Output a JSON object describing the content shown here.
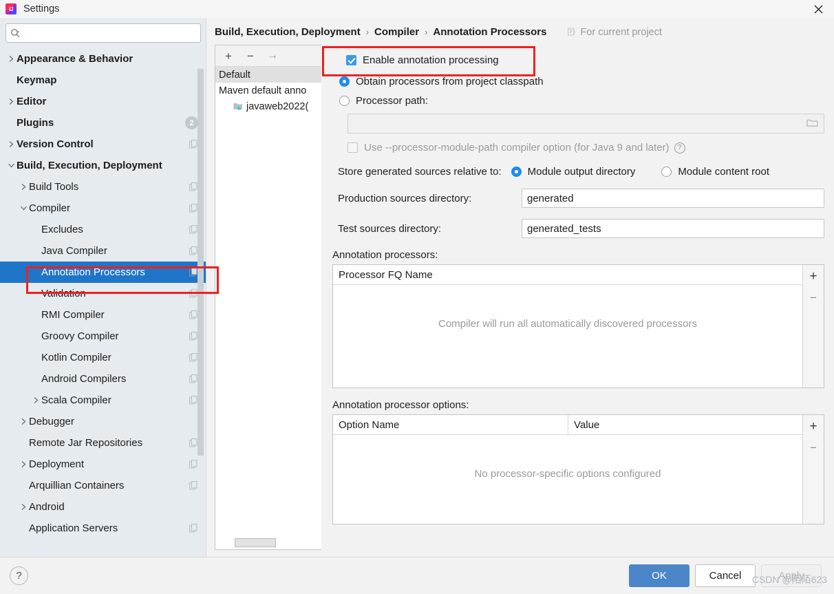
{
  "window": {
    "title": "Settings",
    "app_icon": "intellij-idea-icon",
    "close_icon": "close-icon"
  },
  "search": {
    "placeholder": "",
    "value": "",
    "icon": "search-icon"
  },
  "sidebar": {
    "items": [
      {
        "label": "Appearance & Behavior",
        "twisty": "chevron-right",
        "depth": 0,
        "bold": true,
        "selected": false,
        "copy": false,
        "badge": ""
      },
      {
        "label": "Keymap",
        "twisty": "",
        "depth": 0,
        "bold": true,
        "selected": false,
        "copy": false,
        "badge": ""
      },
      {
        "label": "Editor",
        "twisty": "chevron-right",
        "depth": 0,
        "bold": true,
        "selected": false,
        "copy": false,
        "badge": ""
      },
      {
        "label": "Plugins",
        "twisty": "",
        "depth": 0,
        "bold": true,
        "selected": false,
        "copy": false,
        "badge": "2"
      },
      {
        "label": "Version Control",
        "twisty": "chevron-right",
        "depth": 0,
        "bold": true,
        "selected": false,
        "copy": true,
        "badge": ""
      },
      {
        "label": "Build, Execution, Deployment",
        "twisty": "chevron-down",
        "depth": 0,
        "bold": true,
        "selected": false,
        "copy": false,
        "badge": ""
      },
      {
        "label": "Build Tools",
        "twisty": "chevron-right",
        "depth": 1,
        "bold": false,
        "selected": false,
        "copy": true,
        "badge": ""
      },
      {
        "label": "Compiler",
        "twisty": "chevron-down",
        "depth": 1,
        "bold": false,
        "selected": false,
        "copy": true,
        "badge": ""
      },
      {
        "label": "Excludes",
        "twisty": "",
        "depth": 2,
        "bold": false,
        "selected": false,
        "copy": true,
        "badge": ""
      },
      {
        "label": "Java Compiler",
        "twisty": "",
        "depth": 2,
        "bold": false,
        "selected": false,
        "copy": true,
        "badge": ""
      },
      {
        "label": "Annotation Processors",
        "twisty": "",
        "depth": 2,
        "bold": false,
        "selected": true,
        "copy": true,
        "badge": ""
      },
      {
        "label": "Validation",
        "twisty": "",
        "depth": 2,
        "bold": false,
        "selected": false,
        "copy": true,
        "badge": ""
      },
      {
        "label": "RMI Compiler",
        "twisty": "",
        "depth": 2,
        "bold": false,
        "selected": false,
        "copy": true,
        "badge": ""
      },
      {
        "label": "Groovy Compiler",
        "twisty": "",
        "depth": 2,
        "bold": false,
        "selected": false,
        "copy": true,
        "badge": ""
      },
      {
        "label": "Kotlin Compiler",
        "twisty": "",
        "depth": 2,
        "bold": false,
        "selected": false,
        "copy": true,
        "badge": ""
      },
      {
        "label": "Android Compilers",
        "twisty": "",
        "depth": 2,
        "bold": false,
        "selected": false,
        "copy": true,
        "badge": ""
      },
      {
        "label": "Scala Compiler",
        "twisty": "chevron-right",
        "depth": 2,
        "bold": false,
        "selected": false,
        "copy": true,
        "badge": ""
      },
      {
        "label": "Debugger",
        "twisty": "chevron-right",
        "depth": 1,
        "bold": false,
        "selected": false,
        "copy": false,
        "badge": ""
      },
      {
        "label": "Remote Jar Repositories",
        "twisty": "",
        "depth": 1,
        "bold": false,
        "selected": false,
        "copy": true,
        "badge": ""
      },
      {
        "label": "Deployment",
        "twisty": "chevron-right",
        "depth": 1,
        "bold": false,
        "selected": false,
        "copy": true,
        "badge": ""
      },
      {
        "label": "Arquillian Containers",
        "twisty": "",
        "depth": 1,
        "bold": false,
        "selected": false,
        "copy": true,
        "badge": ""
      },
      {
        "label": "Android",
        "twisty": "chevron-right",
        "depth": 1,
        "bold": false,
        "selected": false,
        "copy": false,
        "badge": ""
      },
      {
        "label": "Application Servers",
        "twisty": "",
        "depth": 1,
        "bold": false,
        "selected": false,
        "copy": true,
        "badge": ""
      }
    ]
  },
  "breadcrumb": {
    "part1": "Build, Execution, Deployment",
    "sep1": "›",
    "part2": "Compiler",
    "sep2": "›",
    "part3": "Annotation Processors",
    "scope_label": "For current project",
    "scope_icon": "project-scope-icon"
  },
  "profiles": {
    "toolbar": {
      "add_label": "+",
      "remove_label": "−",
      "move_label": "→"
    },
    "rows": [
      {
        "label": "Default",
        "selected": true,
        "indent": false,
        "icon": ""
      },
      {
        "label": "Maven default anno",
        "selected": false,
        "indent": false,
        "icon": ""
      },
      {
        "label": "javaweb2022(",
        "selected": false,
        "indent": true,
        "icon": "module-folder-icon"
      }
    ]
  },
  "settings": {
    "enable_annotation_processing": {
      "label": "Enable annotation processing",
      "checked": true
    },
    "obtain_from_classpath": {
      "label": "Obtain processors from project classpath",
      "selected": true
    },
    "processor_path": {
      "label": "Processor path:",
      "selected": false,
      "value": "",
      "browse_icon": "folder-browse-icon"
    },
    "module_path_option": {
      "label": "Use --processor-module-path compiler option (for Java 9 and later)",
      "checked": false,
      "disabled": true,
      "help_icon": "help-icon"
    },
    "store_generated": {
      "caption": "Store generated sources relative to:",
      "option_module_output": {
        "label": "Module output directory",
        "selected": true
      },
      "option_module_content": {
        "label": "Module content root",
        "selected": false
      }
    },
    "production_sources": {
      "label": "Production sources directory:",
      "value": "generated"
    },
    "test_sources": {
      "label": "Test sources directory:",
      "value": "generated_tests"
    },
    "processors_table": {
      "caption": "Annotation processors:",
      "columns": [
        "Processor FQ Name"
      ],
      "rows": [],
      "empty_text": "Compiler will run all automatically discovered processors",
      "add_label": "+",
      "remove_label": "−"
    },
    "options_table": {
      "caption": "Annotation processor options:",
      "columns": [
        "Option Name",
        "Value"
      ],
      "rows": [],
      "empty_text": "No processor-specific options configured",
      "add_label": "+",
      "remove_label": "−"
    }
  },
  "footer": {
    "help_label": "?",
    "ok_label": "OK",
    "cancel_label": "Cancel",
    "apply_label": "Apply",
    "watermark": "CSDN @陌陌623"
  },
  "annotations": {
    "highlight_color": "#f02020",
    "boxes": [
      "sidebar-annotation-processors",
      "enable-annotation-processing"
    ]
  }
}
